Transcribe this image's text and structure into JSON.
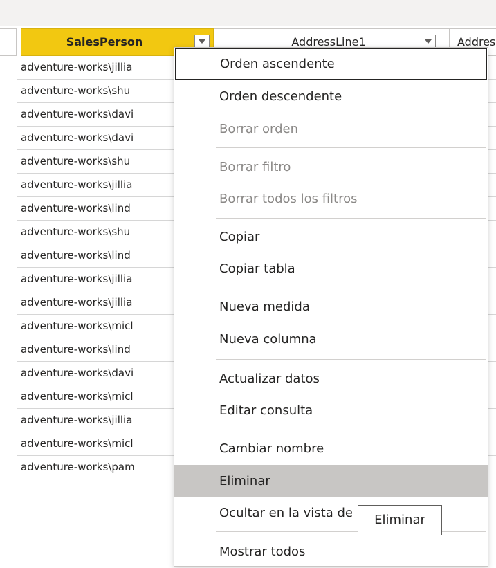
{
  "table": {
    "columns": [
      {
        "label": "SalesPerson"
      },
      {
        "label": "AddressLine1"
      },
      {
        "label": "Addres"
      }
    ],
    "rows": [
      "adventure-works\\jillia",
      "adventure-works\\shu",
      "adventure-works\\davi",
      "adventure-works\\davi",
      "adventure-works\\shu",
      "adventure-works\\jillia",
      "adventure-works\\lind",
      "adventure-works\\shu",
      "adventure-works\\lind",
      "adventure-works\\jillia",
      "adventure-works\\jillia",
      "adventure-works\\micl",
      "adventure-works\\lind",
      "adventure-works\\davi",
      "adventure-works\\micl",
      "adventure-works\\jillia",
      "adventure-works\\micl",
      "adventure-works\\pam"
    ]
  },
  "context_menu": {
    "items": [
      {
        "label": "Orden ascendente",
        "state": "focused"
      },
      {
        "label": "Orden descendente",
        "state": "enabled"
      },
      {
        "label": "Borrar orden",
        "state": "disabled"
      },
      {
        "label": "Borrar filtro",
        "state": "disabled"
      },
      {
        "label": "Borrar todos los filtros",
        "state": "disabled"
      },
      {
        "label": "Copiar",
        "state": "enabled"
      },
      {
        "label": "Copiar tabla",
        "state": "enabled"
      },
      {
        "label": "Nueva medida",
        "state": "enabled"
      },
      {
        "label": "Nueva columna",
        "state": "enabled"
      },
      {
        "label": "Actualizar datos",
        "state": "enabled"
      },
      {
        "label": "Editar consulta",
        "state": "enabled"
      },
      {
        "label": "Cambiar nombre",
        "state": "enabled"
      },
      {
        "label": "Eliminar",
        "state": "hover"
      },
      {
        "label": "Ocultar en la vista de informes",
        "state": "enabled"
      },
      {
        "label": "Mostrar todos",
        "state": "enabled"
      }
    ]
  },
  "tooltip": {
    "text": "Eliminar"
  },
  "colors": {
    "header_accent": "#f2c811",
    "hover_bg": "#c8c6c4",
    "disabled_text": "#8a8886"
  },
  "icons": {
    "column_dropdown": "chevron-down-icon"
  }
}
